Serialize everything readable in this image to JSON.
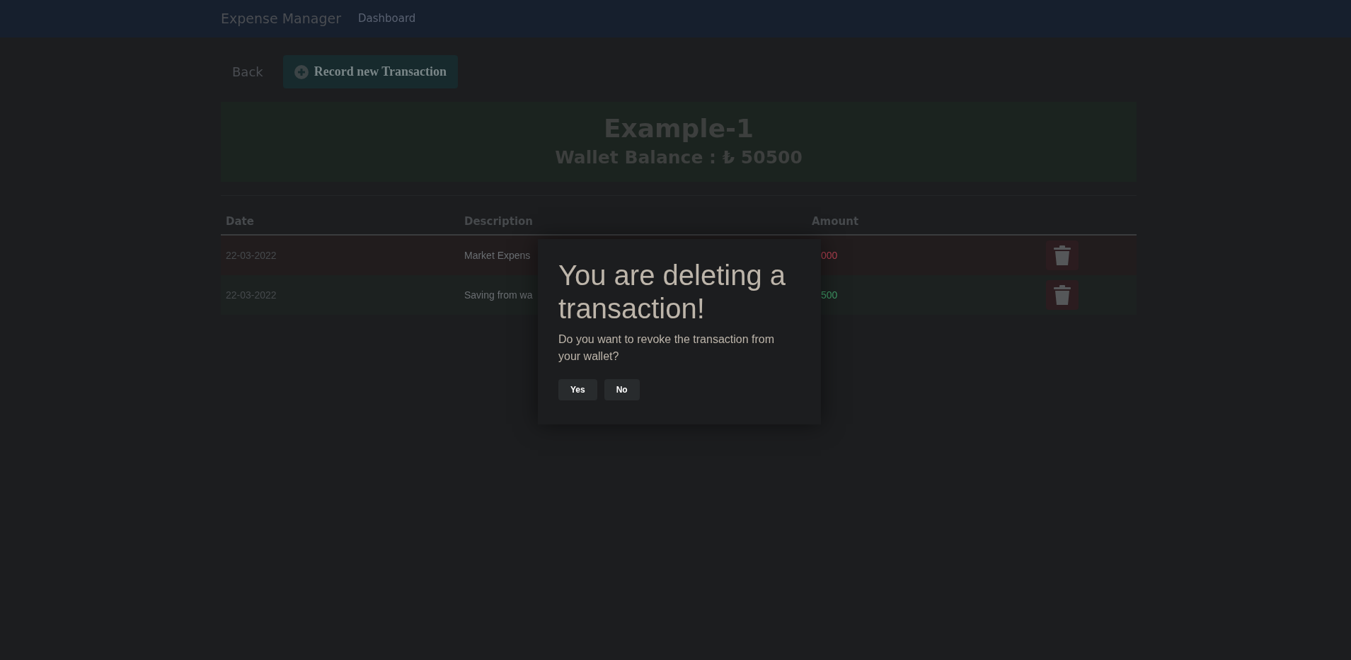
{
  "navbar": {
    "brand": "Expense Manager",
    "links": [
      "Dashboard"
    ]
  },
  "toolbar": {
    "back": "Back",
    "record_button": "Record new Transaction"
  },
  "wallet": {
    "name": "Example-1",
    "balance": "Wallet Balance : ₺ 50500"
  },
  "table": {
    "columns": [
      "Date",
      "Description",
      "Amount"
    ],
    "rows": [
      {
        "kind": "expense",
        "date": "22-03-2022",
        "description": "Market Expens",
        "amount": "000"
      },
      {
        "kind": "income",
        "date": "22-03-2022",
        "description": "Saving from wa",
        "amount": "500"
      }
    ]
  },
  "dialog": {
    "title": "You are deleting a transaction!",
    "message": "Do you want to revoke the transaction from your wallet?",
    "buttons": [
      "Yes",
      "No"
    ]
  }
}
